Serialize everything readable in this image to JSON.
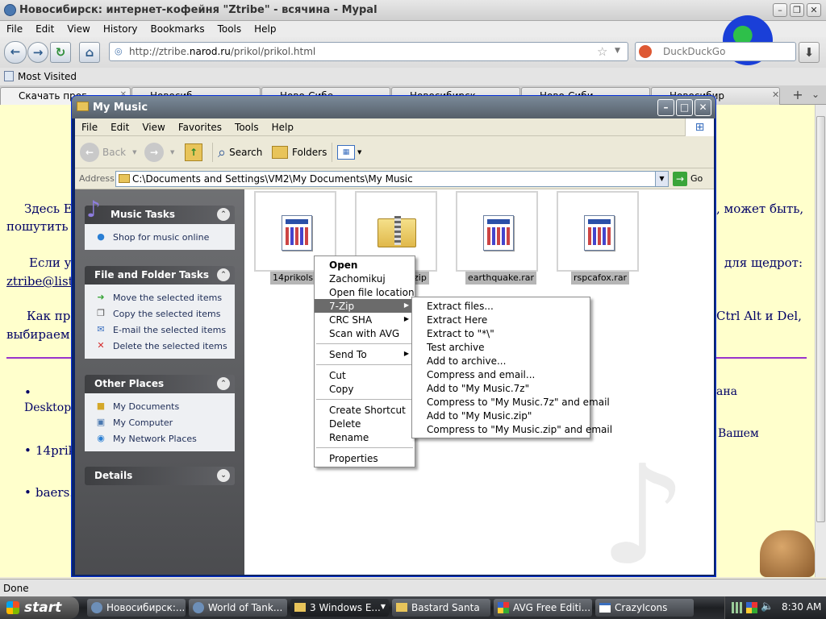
{
  "browser": {
    "title": "Новосибирск: интернет-кофейня \"Ztribe\" - всячина - Mypal",
    "menu": [
      "File",
      "Edit",
      "View",
      "History",
      "Bookmarks",
      "Tools",
      "Help"
    ],
    "url_prefix": "http://ztribe.",
    "url_host": "narod.ru",
    "url_path": "/prikol/prikol.html",
    "search_placeholder": "DuckDuckGo",
    "bookmark": "Most Visited",
    "tabs": [
      "Скачать прог",
      "Новосиб",
      "Ново-Сибе",
      "Новосибирск",
      "Ново-Сиби",
      "Новосибир"
    ],
    "status": "Done"
  },
  "page": {
    "p1a": "Здесь Е",
    "p1b": "пошутить",
    "p1c": ", может быть,",
    "p2a": "Если у",
    "p2b": "для щедрот:",
    "p2c": "ztribe@list",
    "p3a": "Как пр",
    "p3b": "выбираем",
    "p3c": "Ctrl Alt и Del,",
    "li1a": "DesktopF",
    "li1b": "ана",
    "li2a": "14prik",
    "li2b": "Вашем",
    "li3a": "baers.ra"
  },
  "explorer": {
    "title": "My Music",
    "menu": [
      "File",
      "Edit",
      "View",
      "Favorites",
      "Tools",
      "Help"
    ],
    "back": "Back",
    "search": "Search",
    "folders": "Folders",
    "address_label": "Address",
    "address": "C:\\Documents and Settings\\VM2\\My Documents\\My Music",
    "go": "Go",
    "panels": {
      "music_tasks": {
        "title": "Music Tasks",
        "items": [
          "Shop for music online"
        ]
      },
      "file_tasks": {
        "title": "File and Folder Tasks",
        "items": [
          "Move the selected items",
          "Copy the selected items",
          "E-mail the selected items",
          "Delete the selected items"
        ]
      },
      "other_places": {
        "title": "Other Places",
        "items": [
          "My Documents",
          "My Computer",
          "My Network Places"
        ]
      },
      "details": {
        "title": "Details"
      }
    },
    "files": [
      "14prikols.rar",
      "zip",
      "earthquake.rar",
      "rspcafox.rar"
    ]
  },
  "context_menu": {
    "items": [
      "Open",
      "Zachomikuj",
      "Open file location",
      "7-Zip",
      "CRC SHA",
      "Scan with AVG",
      "Send To",
      "Cut",
      "Copy",
      "Create Shortcut",
      "Delete",
      "Rename",
      "Properties"
    ]
  },
  "submenu_7zip": {
    "items": [
      "Extract files...",
      "Extract Here",
      "Extract to \"*\\\"",
      "Test archive",
      "Add to archive...",
      "Compress and email...",
      "Add to \"My Music.7z\"",
      "Compress to \"My Music.7z\" and email",
      "Add to \"My Music.zip\"",
      "Compress to \"My Music.zip\" and email"
    ]
  },
  "taskbar": {
    "start": "start",
    "tasks": [
      "Новосибирск:...",
      "World of Tank...",
      "3 Windows E...",
      "Bastard Santa",
      "AVG Free Editi...",
      "CrazyIcons"
    ],
    "clock": "8:30 AM"
  },
  "colors": {
    "page_bg": "#ffffcc",
    "page_text": "#000066",
    "rule": "#9933cc",
    "selection": "#6b6b6b"
  }
}
